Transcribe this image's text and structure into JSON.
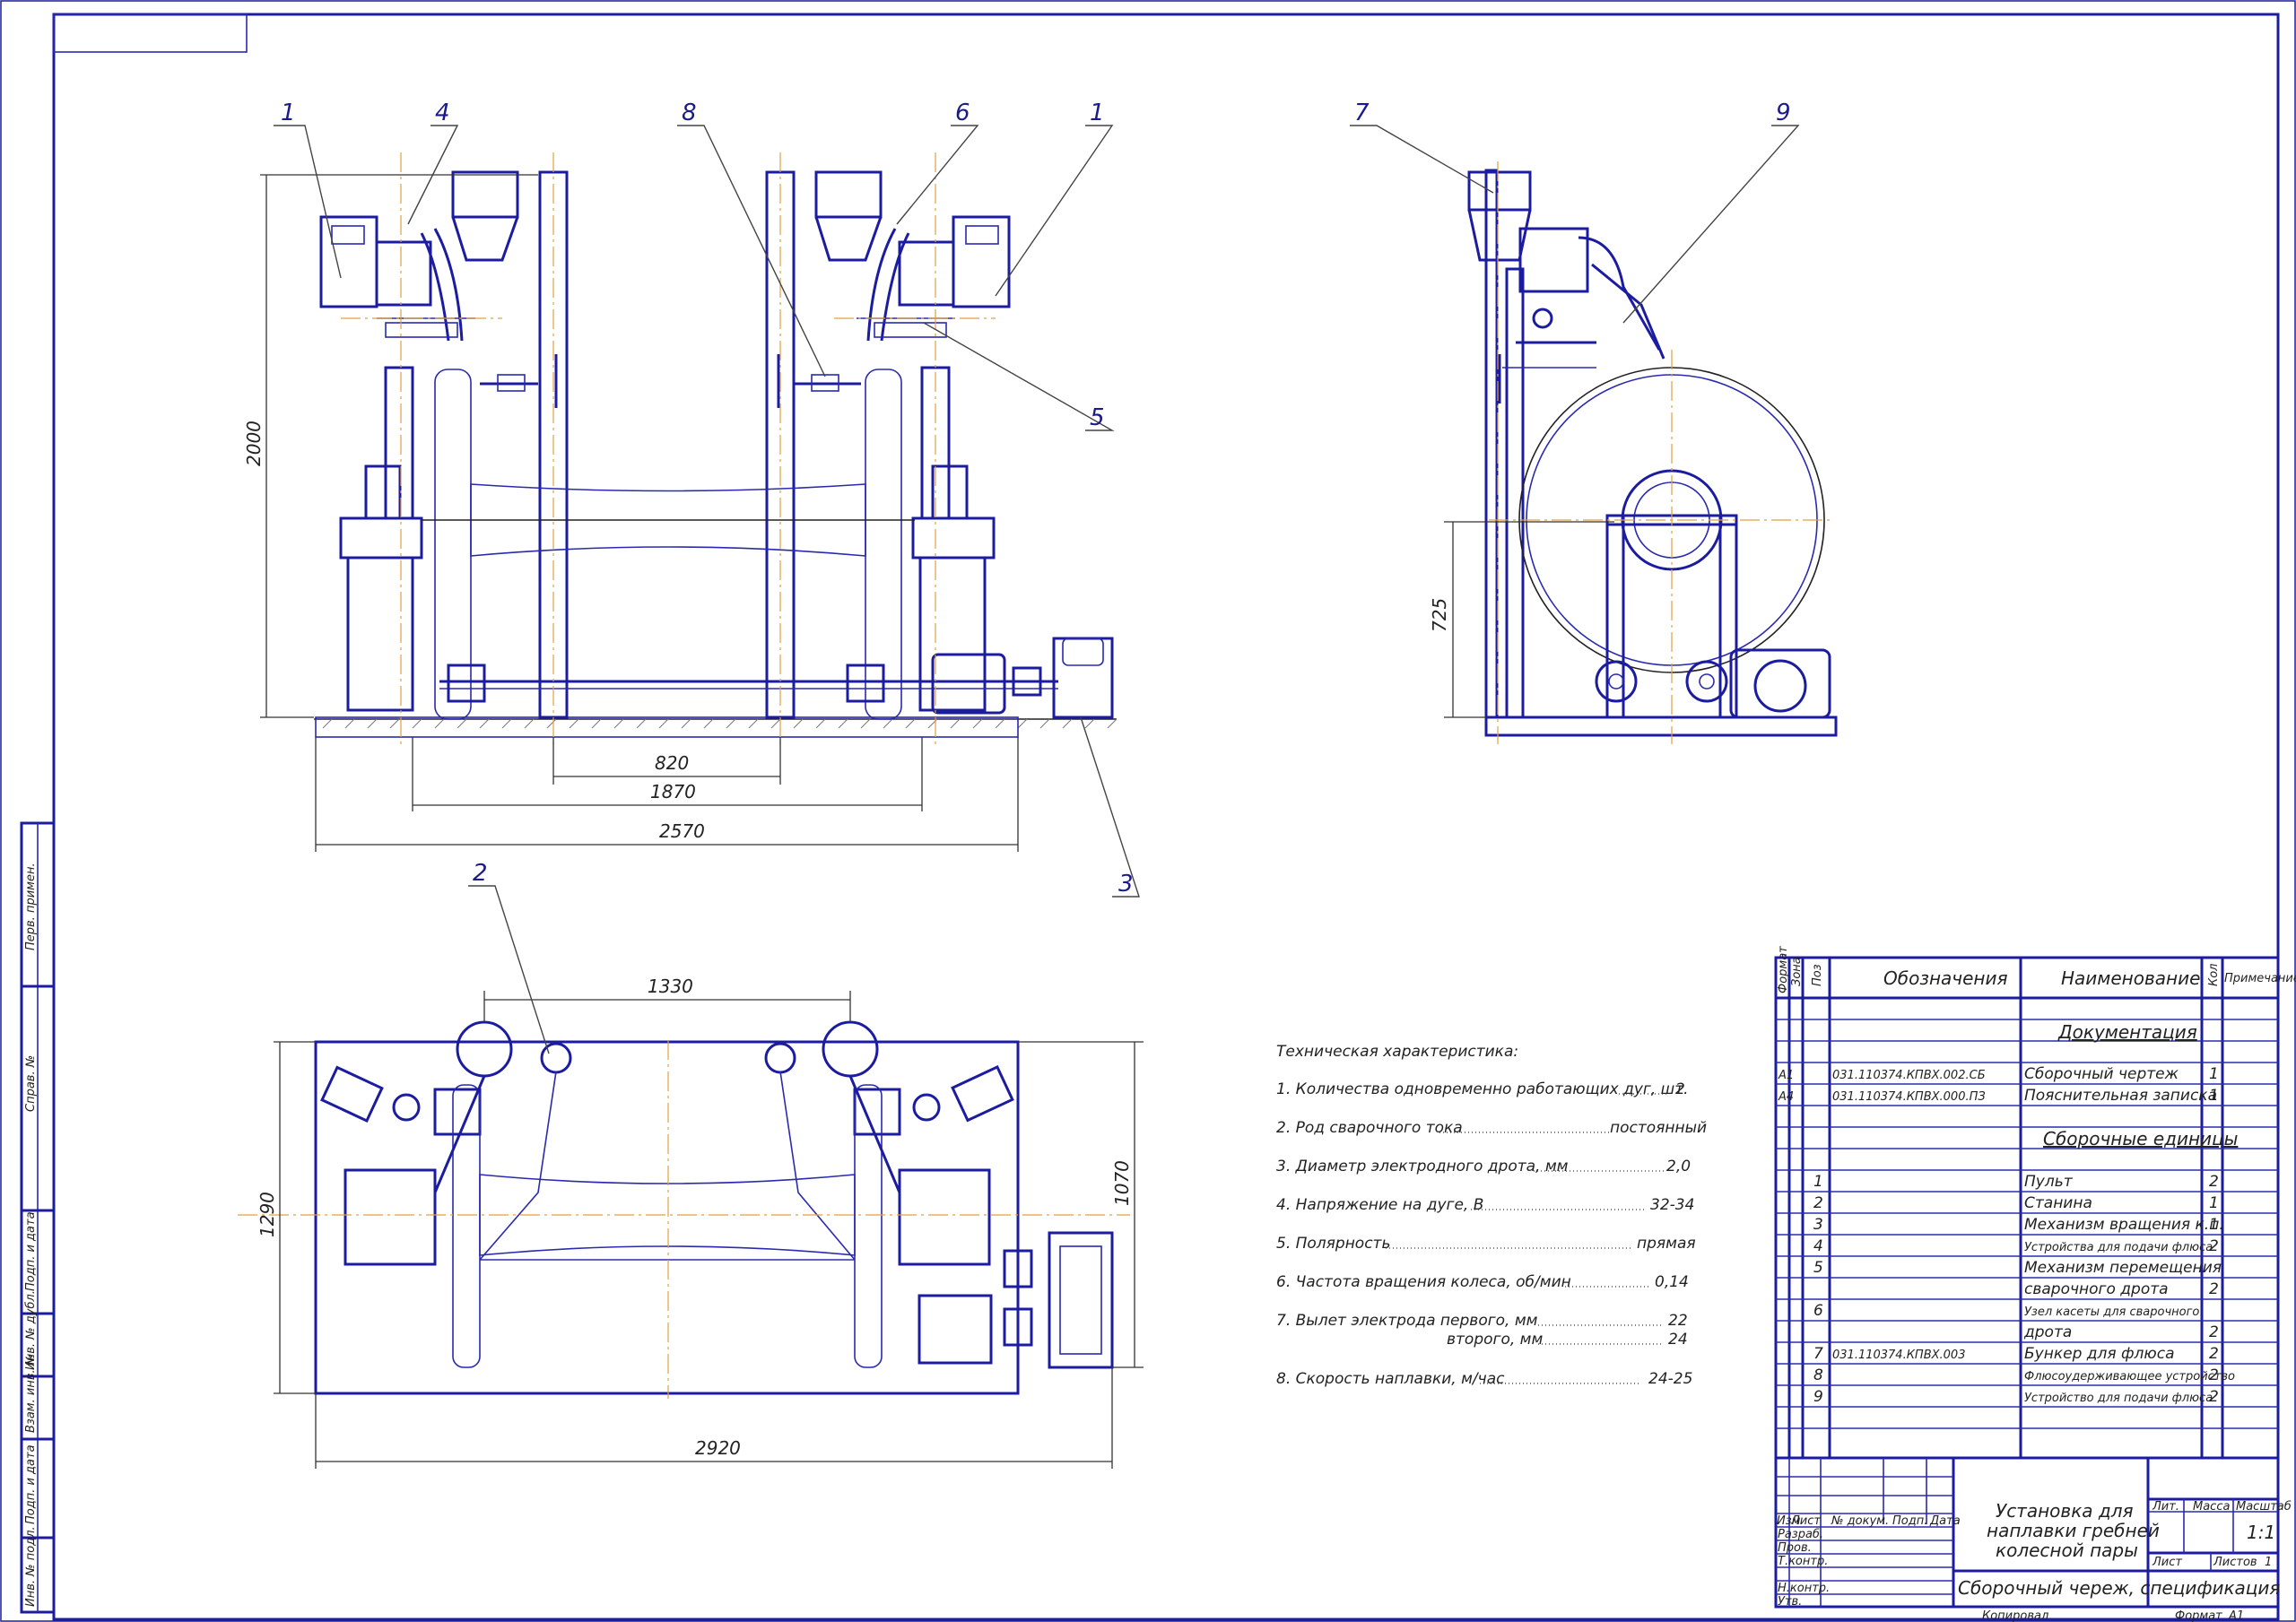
{
  "drawing": {
    "positions": [
      "1",
      "4",
      "8",
      "6",
      "1",
      "5",
      "3",
      "7",
      "9",
      "2"
    ],
    "dimensions": {
      "front_height": "2000",
      "gap_820": "820",
      "gap_1870": "1870",
      "width_2570": "2570",
      "side_height": "725",
      "plan_1330": "1330",
      "plan_1290": "1290",
      "plan_1070": "1070",
      "plan_2920": "2920"
    }
  },
  "tech": {
    "title": "Техническая характеристика:",
    "lines": [
      {
        "label": "1. Количества одновременно работающих дуг, шт.",
        "value": "2"
      },
      {
        "label": "2. Род сварочного тока",
        "value": "постоянный"
      },
      {
        "label": "3. Диаметр электродного дрота, мм",
        "value": "2,0"
      },
      {
        "label": "4. Напряжение на дуге, В",
        "value": "32-34"
      },
      {
        "label": "5. Полярность",
        "value": "прямая"
      },
      {
        "label": "6. Частота вращения колеса, об/мин",
        "value": "0,14"
      },
      {
        "label": "7. Вылет электрода первого, мм",
        "value": "22"
      },
      {
        "label": "второго, мм",
        "value": "24"
      },
      {
        "label": "8. Скорость наплавки, м/час",
        "value": "24-25"
      }
    ]
  },
  "spec": {
    "headers": {
      "format": "Формат",
      "zone": "Зона",
      "pos": "Поз",
      "designation": "Обозначения",
      "name": "Наименование",
      "qty": "Кол",
      "note": "Примечание"
    },
    "section_docs": "Документация",
    "section_units": "Сборочные единицы",
    "rows": [
      {
        "format": "А1",
        "pos": "",
        "designation": "031.110374.КПВХ.002.СБ",
        "name": "Сборочный чертеж",
        "qty": "1"
      },
      {
        "format": "А4",
        "pos": "",
        "designation": "031.110374.КПВХ.000.ПЗ",
        "name": "Пояснительная записка",
        "qty": "1"
      },
      {
        "format": "",
        "pos": "1",
        "designation": "",
        "name": "Пульт",
        "qty": "2"
      },
      {
        "format": "",
        "pos": "2",
        "designation": "",
        "name": "Станина",
        "qty": "1"
      },
      {
        "format": "",
        "pos": "3",
        "designation": "",
        "name": "Механизм вращения к.п.",
        "qty": "1"
      },
      {
        "format": "",
        "pos": "4",
        "designation": "",
        "name": "Устройства для подачи флюса",
        "qty": "2"
      },
      {
        "format": "",
        "pos": "5",
        "designation": "",
        "name": "Механизм перемещения",
        "qty": ""
      },
      {
        "format": "",
        "pos": "",
        "designation": "",
        "name": "сварочного дрота",
        "qty": "2"
      },
      {
        "format": "",
        "pos": "6",
        "designation": "",
        "name": "Узел касеты для сварочного",
        "qty": ""
      },
      {
        "format": "",
        "pos": "",
        "designation": "",
        "name": "дрота",
        "qty": "2"
      },
      {
        "format": "",
        "pos": "7",
        "designation": "031.110374.КПВХ.003",
        "name": "Бункер для флюса",
        "qty": "2"
      },
      {
        "format": "",
        "pos": "8",
        "designation": "",
        "name": "Флюсоудерживающее устройство",
        "qty": "2"
      },
      {
        "format": "",
        "pos": "9",
        "designation": "",
        "name": "Устройство для подачи флюса",
        "qty": "2"
      }
    ]
  },
  "title_block": {
    "title_lines": [
      "Установка для",
      "наплавки гребней",
      "колесной пары"
    ],
    "doc_type": "Сборочный череж, спецификация",
    "lit": "Лит.",
    "mass": "Масса",
    "scale_label": "Масштаб",
    "scale": "1:1",
    "sheet": "Лист",
    "sheets": "Листов",
    "sheets_count": "1",
    "roles": [
      "Изм",
      "Лист",
      "№ докум.",
      "Подп.",
      "Дата"
    ],
    "signers": [
      "Разраб.",
      "Пров.",
      "Т.контр.",
      "",
      "Н.контр.",
      "Утв."
    ],
    "copied": "Копировал",
    "format_label": "Формат",
    "format": "А1"
  },
  "side_stamp": [
    "Перв. примен.",
    "Справ. №",
    "Подп. и дата",
    "Инв. № дубл.",
    "Взам. инв. №",
    "Подп. и дата",
    "Инв. № подл."
  ]
}
